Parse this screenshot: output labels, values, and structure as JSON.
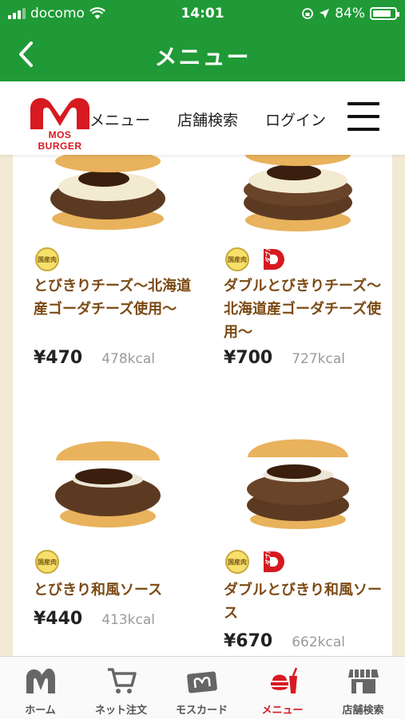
{
  "status": {
    "carrier": "docomo",
    "time": "14:01",
    "battery_text": "84%",
    "battery_level": 0.84
  },
  "appbar": {
    "title": "メニュー"
  },
  "site_header": {
    "logo_text": "MOS BURGER",
    "nav": [
      "メニュー",
      "店舗検索",
      "ログイン"
    ]
  },
  "products": [
    {
      "name": "とびきりチーズ〜北海道産ゴーダチーズ使用〜",
      "price": "¥470",
      "kcal": "478kcal",
      "badges": [
        "kokusan"
      ]
    },
    {
      "name": "ダブルとびきりチーズ〜北海道産ゴーダチーズ使用〜",
      "price": "¥700",
      "kcal": "727kcal",
      "badges": [
        "kokusan",
        "double"
      ]
    },
    {
      "name": "とびきり和風ソース",
      "price": "¥440",
      "kcal": "413kcal",
      "badges": [
        "kokusan"
      ]
    },
    {
      "name": "ダブルとびきり和風ソース",
      "price": "¥670",
      "kcal": "662kcal",
      "badges": [
        "kokusan",
        "double"
      ]
    }
  ],
  "badge_text": {
    "kokusan": "国産肉",
    "double": "ダブル"
  },
  "tabbar": [
    {
      "label": "ホーム",
      "icon": "mos-logo-icon",
      "active": false
    },
    {
      "label": "ネット注文",
      "icon": "cart-icon",
      "active": false
    },
    {
      "label": "モスカード",
      "icon": "card-icon",
      "active": false
    },
    {
      "label": "メニュー",
      "icon": "burger-drink-icon",
      "active": true
    },
    {
      "label": "店舗検索",
      "icon": "store-icon",
      "active": false
    }
  ],
  "colors": {
    "brand_green": "#1f9a36",
    "brand_red": "#d71920",
    "name_brown": "#7b4a14"
  }
}
